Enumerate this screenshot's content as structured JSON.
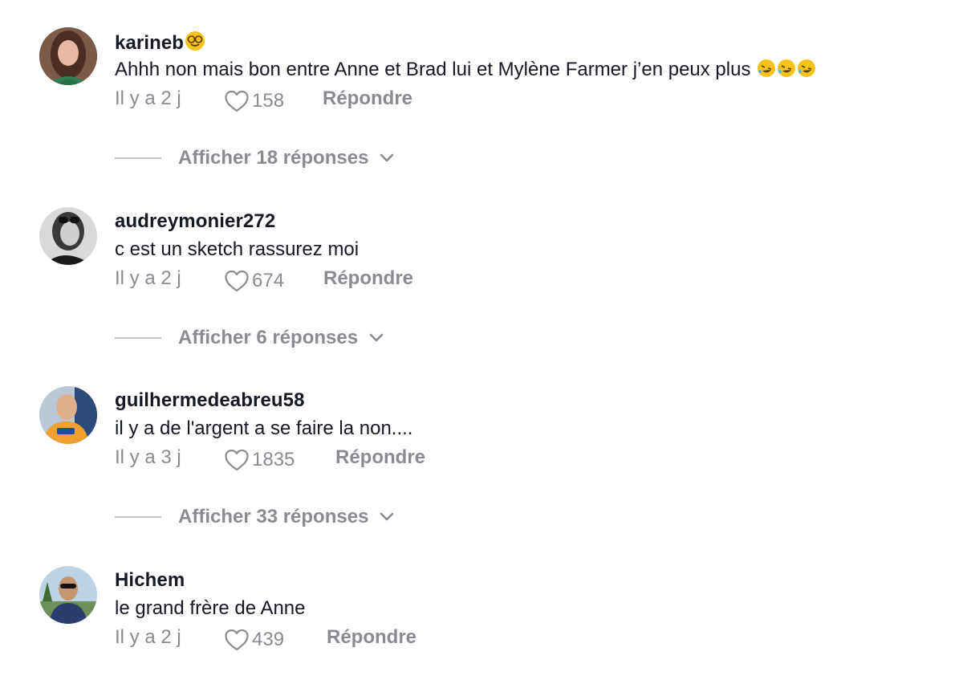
{
  "comments": [
    {
      "username": "karineb",
      "username_emoji": "smiling-face-with-glasses-emoji",
      "text": "Ahhh non mais bon entre Anne et Brad lui et Mylène Farmer j’en peux plus",
      "text_emoji": [
        "rolling-on-floor-laughing-emoji",
        "rolling-on-floor-laughing-emoji",
        "rolling-on-floor-laughing-emoji"
      ],
      "time": "Il y a 2 j",
      "likes": "158",
      "reply_label": "Répondre",
      "view_replies": "Afficher 18 réponses"
    },
    {
      "username": "audreymonier272",
      "text": "c est un sketch rassurez moi",
      "time": "Il y a 2 j",
      "likes": "674",
      "reply_label": "Répondre",
      "view_replies": "Afficher 6 réponses"
    },
    {
      "username": "guilhermedeabreu58",
      "text": "il y a de l'argent a se faire la non....",
      "time": "Il y a 3 j",
      "likes": "1835",
      "reply_label": "Répondre",
      "view_replies": "Afficher 33 réponses"
    },
    {
      "username": "Hichem",
      "text": "le grand frère de Anne",
      "time": "Il y a 2 j",
      "likes": "439",
      "reply_label": "Répondre"
    }
  ],
  "icons": {
    "like": "heart-outline-icon",
    "expand": "chevron-down-icon"
  },
  "colors": {
    "text_primary": "#161823",
    "text_secondary": "#8a8b91",
    "divider": "#c6c7cb",
    "emoji_yellow": "#f7c21a"
  }
}
